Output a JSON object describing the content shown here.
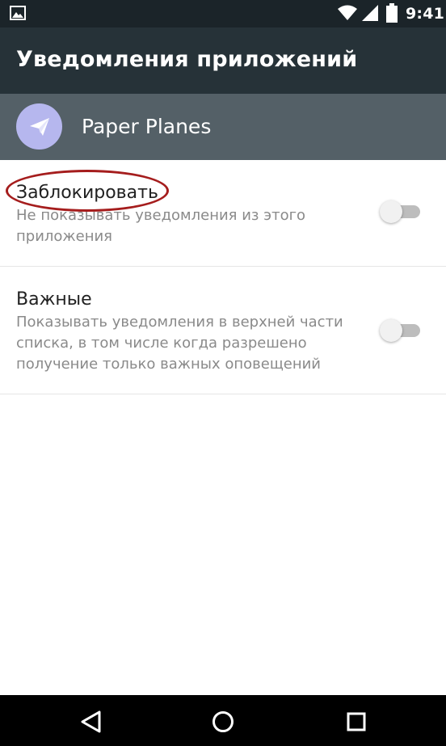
{
  "status_bar": {
    "time": "9:41",
    "icons": [
      "gallery-icon",
      "wifi-icon",
      "signal-icon",
      "battery-icon"
    ]
  },
  "app_bar": {
    "title": "Уведомления приложений"
  },
  "app_header": {
    "app_name": "Paper Planes",
    "icon": "paper-plane-icon",
    "icon_color": "#b6b7ee"
  },
  "preferences": {
    "block": {
      "title": "Заблокировать",
      "summary": "Не показывать уведомления из этого приложения",
      "enabled": false
    },
    "priority": {
      "title": "Важные",
      "summary": "Показывать уведомления в верхней части списка, в том числе когда разрешено получение только важных оповещений",
      "enabled": false
    }
  },
  "annotation": {
    "color": "#a51d1d"
  },
  "nav_bar": {
    "icons": [
      "back-icon",
      "home-icon",
      "recents-icon"
    ]
  },
  "colors": {
    "status_bar": "#1b2429",
    "app_bar": "#263238",
    "app_header": "#546067"
  }
}
